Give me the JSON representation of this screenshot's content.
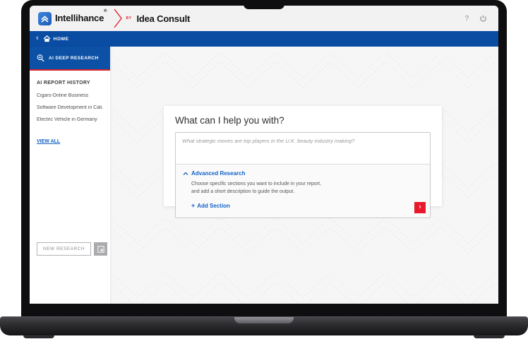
{
  "topbar": {
    "brand_primary": "Intellihance",
    "brand_reg": "®",
    "brand_by": "BY",
    "brand_secondary": "Idea Consult"
  },
  "navbar": {
    "home_label": "HOME"
  },
  "sidebar": {
    "active_tab_label": "AI DEEP RESEARCH",
    "history": {
      "title": "AI REPORT HISTORY",
      "items": [
        "Cigars-Online Business",
        "Software Development in Cali...",
        "Electric Vehicle in Germany"
      ],
      "view_all_label": "VIEW ALL"
    },
    "new_research_label": "NEW RESEARCH"
  },
  "main": {
    "prompt_card": {
      "heading": "What can I help you with?",
      "input_placeholder": "What strategic moves are top players in the U.K. beauty industry making?",
      "input_value": "",
      "advanced": {
        "toggle_label": "Advanced Research",
        "description_line1": "Choose specific sections you want to include in your report,",
        "description_line2": "and add a short description to guide the output.",
        "add_section_label": "Add Section"
      }
    }
  },
  "icons": {
    "help": "?",
    "back": "‹",
    "submit": "›",
    "add": "+"
  },
  "colors": {
    "navbar_blue": "#0b4ca3",
    "sidebar_tab_blue": "#0d51a6",
    "accent_red": "#e8192c",
    "link_blue": "#1464c8"
  }
}
